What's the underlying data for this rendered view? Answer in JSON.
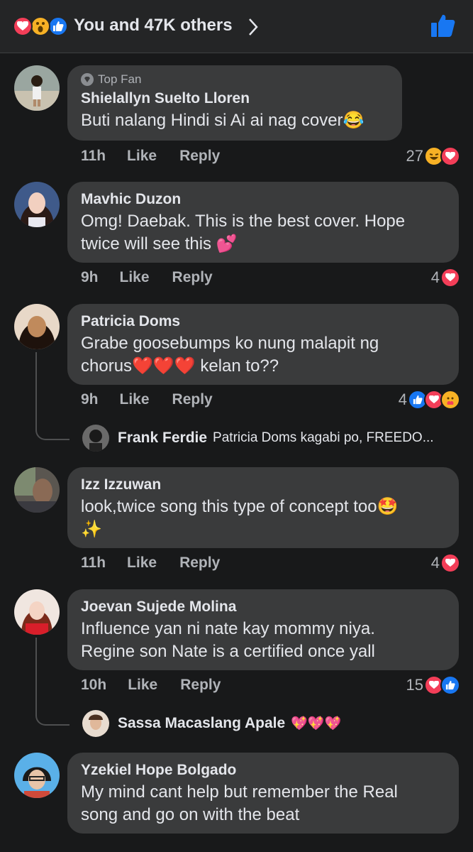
{
  "header": {
    "summary": "You and 47K others",
    "reaction_icons": [
      "heart-reaction",
      "wow-reaction",
      "like-reaction"
    ]
  },
  "colors": {
    "background": "#18191a",
    "bubble": "#3a3b3c",
    "like_blue": "#1877f2",
    "heart_red": "#f33e58",
    "muted_text": "#b0b3b8"
  },
  "comments": [
    {
      "badge": "Top Fan",
      "author": "Shielallyn Suelto Lloren",
      "text": "Buti nalang Hindi si Ai ai nag cover😂",
      "time": "11h",
      "like": "Like",
      "reply": "Reply",
      "reaction_count": "27",
      "reactions": [
        "haha",
        "heart"
      ]
    },
    {
      "author": "Mavhic Duzon",
      "text_line1": "Omg! Daebak. This is the best cover. Hope",
      "text_line2": "twice will see this 💕",
      "time": "9h",
      "like": "Like",
      "reply": "Reply",
      "reaction_count": "4",
      "reactions": [
        "heart"
      ]
    },
    {
      "author": "Patricia Doms",
      "text_line1": "Grabe goosebumps ko nung malapit ng",
      "text_line2": "chorus❤️❤️❤️ kelan to??",
      "time": "9h",
      "like": "Like",
      "reply": "Reply",
      "reaction_count": "4",
      "reactions": [
        "like",
        "heart",
        "care"
      ],
      "reply_preview": {
        "author": "Frank Ferdie",
        "text": "Patricia Doms kagabi po, FREEDO..."
      }
    },
    {
      "author": "Izz Izzuwan",
      "text_line1": "look,twice song this type of concept too🤩",
      "text_line2": "✨",
      "time": "11h",
      "like": "Like",
      "reply": "Reply",
      "reaction_count": "4",
      "reactions": [
        "heart"
      ]
    },
    {
      "author": "Joevan Sujede Molina",
      "text_line1": "Influence yan ni nate kay mommy niya.",
      "text_line2": "Regine son Nate is a certified once yall",
      "time": "10h",
      "like": "Like",
      "reply": "Reply",
      "reaction_count": "15",
      "reactions": [
        "heart",
        "like"
      ],
      "reply_preview": {
        "author": "Sassa Macaslang Apale",
        "text": "💖💖💖"
      }
    },
    {
      "author": "Yzekiel Hope Bolgado",
      "text_line1": "My mind cant help but remember the Real",
      "text_line2": "song and go on with the beat"
    }
  ]
}
